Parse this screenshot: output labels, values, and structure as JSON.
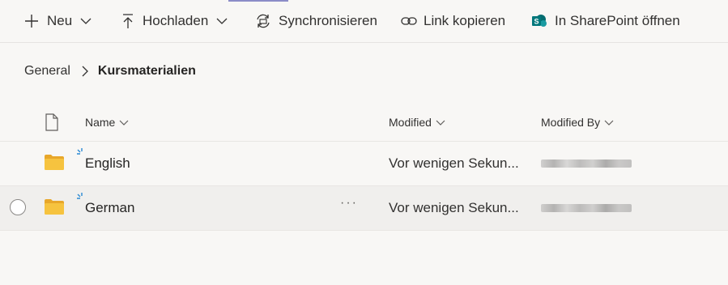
{
  "toolbar": {
    "new_label": "Neu",
    "upload_label": "Hochladen",
    "sync_label": "Synchronisieren",
    "copy_link_label": "Link kopieren",
    "sharepoint_label": "In SharePoint öffnen"
  },
  "breadcrumb": {
    "root": "General",
    "current": "Kursmaterialien"
  },
  "table": {
    "columns": {
      "name": "Name",
      "modified": "Modified",
      "modified_by": "Modified By"
    },
    "rows": [
      {
        "name": "English",
        "modified": "Vor wenigen Sekun...",
        "modified_by": ""
      },
      {
        "name": "German",
        "modified": "Vor wenigen Sekun...",
        "modified_by": "",
        "more": "···"
      }
    ]
  },
  "colors": {
    "folder": "#f6c33f",
    "sync_spinner": "#2a8ad4",
    "accent": "#8b8cc7"
  }
}
